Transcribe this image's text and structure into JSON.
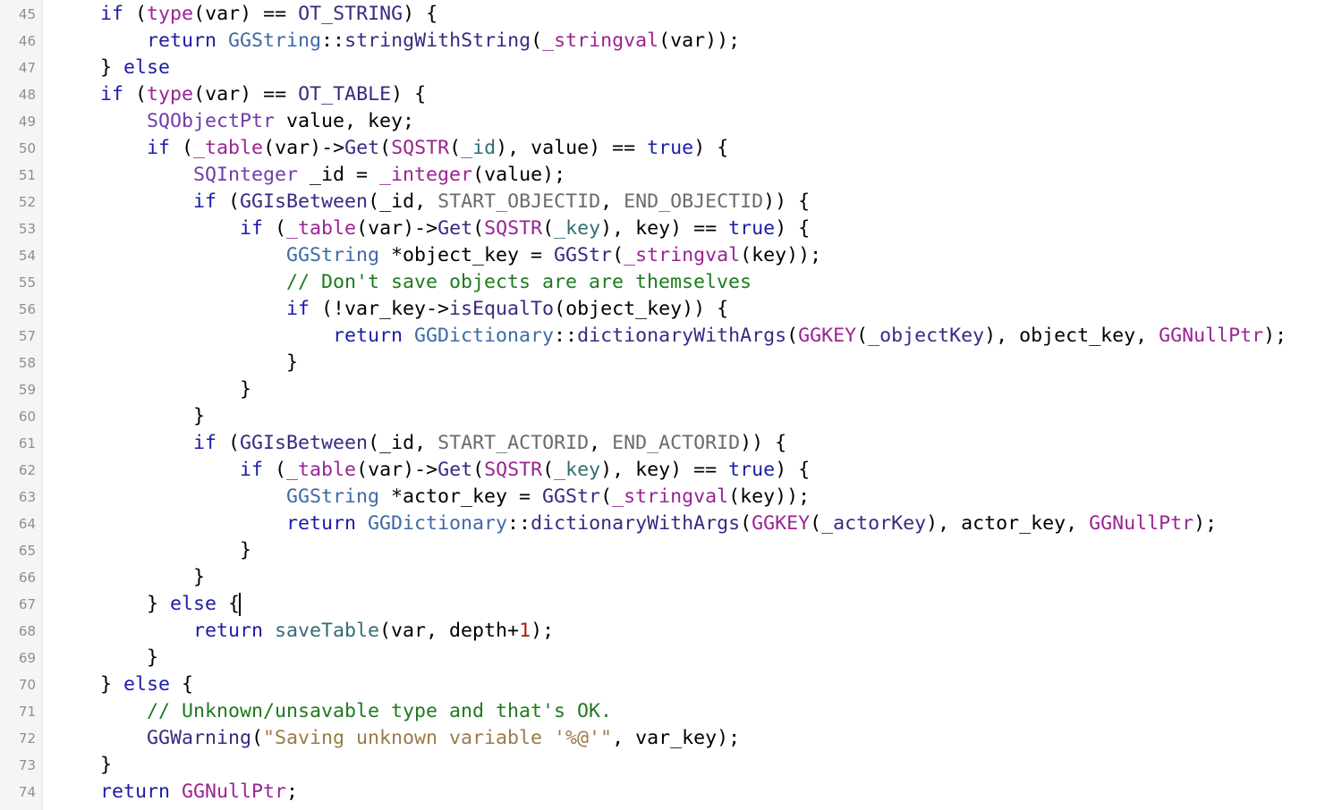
{
  "editor": {
    "cursor": {
      "line": 67,
      "after_token": "{"
    },
    "colors": {
      "keyword": "#1c1ca8",
      "function": "#9b2393",
      "class": "#3e6aa6",
      "type": "#703daa",
      "method": "#3b2882",
      "constant": "#6b6b6b",
      "variable": "#326d74",
      "number": "#b01818",
      "string": "#9c7a47",
      "comment": "#1e7a1e",
      "plain": "#000000",
      "gutter_bg": "#f5f5f5",
      "line_number": "#8e8e8e"
    },
    "lines": [
      {
        "n": "45",
        "indent": 4,
        "tokens": [
          [
            "kw",
            "if"
          ],
          [
            "plain",
            " ("
          ],
          [
            "fn",
            "type"
          ],
          [
            "plain",
            "(var) == "
          ],
          [
            "macro",
            "OT_STRING"
          ],
          [
            "plain",
            ") {"
          ]
        ]
      },
      {
        "n": "46",
        "indent": 8,
        "tokens": [
          [
            "kw",
            "return "
          ],
          [
            "cls",
            "GGString"
          ],
          [
            "plain",
            "::"
          ],
          [
            "meth",
            "stringWithString"
          ],
          [
            "plain",
            "("
          ],
          [
            "fn",
            "_stringval"
          ],
          [
            "plain",
            "(var));"
          ]
        ]
      },
      {
        "n": "47",
        "indent": 4,
        "tokens": [
          [
            "plain",
            "} "
          ],
          [
            "kw",
            "else"
          ]
        ]
      },
      {
        "n": "48",
        "indent": 4,
        "tokens": [
          [
            "kw",
            "if"
          ],
          [
            "plain",
            " ("
          ],
          [
            "fn",
            "type"
          ],
          [
            "plain",
            "(var) == "
          ],
          [
            "macro",
            "OT_TABLE"
          ],
          [
            "plain",
            ") {"
          ]
        ]
      },
      {
        "n": "49",
        "indent": 8,
        "tokens": [
          [
            "type",
            "SQObjectPtr"
          ],
          [
            "plain",
            " value, key;"
          ]
        ]
      },
      {
        "n": "50",
        "indent": 8,
        "tokens": [
          [
            "kw",
            "if"
          ],
          [
            "plain",
            " ("
          ],
          [
            "fn",
            "_table"
          ],
          [
            "plain",
            "(var)->"
          ],
          [
            "meth",
            "Get"
          ],
          [
            "plain",
            "("
          ],
          [
            "fn",
            "SQSTR"
          ],
          [
            "plain",
            "("
          ],
          [
            "var",
            "_id"
          ],
          [
            "plain",
            "), value) == "
          ],
          [
            "kw",
            "true"
          ],
          [
            "plain",
            ") {"
          ]
        ]
      },
      {
        "n": "51",
        "indent": 12,
        "tokens": [
          [
            "type",
            "SQInteger"
          ],
          [
            "plain",
            " _id = "
          ],
          [
            "fn",
            "_integer"
          ],
          [
            "plain",
            "(value);"
          ]
        ]
      },
      {
        "n": "52",
        "indent": 12,
        "tokens": [
          [
            "kw",
            "if"
          ],
          [
            "plain",
            " ("
          ],
          [
            "meth",
            "GGIsBetween"
          ],
          [
            "plain",
            "(_id, "
          ],
          [
            "const",
            "START_OBJECTID"
          ],
          [
            "plain",
            ", "
          ],
          [
            "const",
            "END_OBJECTID"
          ],
          [
            "plain",
            ")) {"
          ]
        ]
      },
      {
        "n": "53",
        "indent": 16,
        "tokens": [
          [
            "kw",
            "if"
          ],
          [
            "plain",
            " ("
          ],
          [
            "fn",
            "_table"
          ],
          [
            "plain",
            "(var)->"
          ],
          [
            "meth",
            "Get"
          ],
          [
            "plain",
            "("
          ],
          [
            "fn",
            "SQSTR"
          ],
          [
            "plain",
            "("
          ],
          [
            "var",
            "_key"
          ],
          [
            "plain",
            "), key) == "
          ],
          [
            "kw",
            "true"
          ],
          [
            "plain",
            ") {"
          ]
        ]
      },
      {
        "n": "54",
        "indent": 20,
        "tokens": [
          [
            "cls",
            "GGString"
          ],
          [
            "plain",
            " *object_key = "
          ],
          [
            "meth",
            "GGStr"
          ],
          [
            "plain",
            "("
          ],
          [
            "fn",
            "_stringval"
          ],
          [
            "plain",
            "(key));"
          ]
        ]
      },
      {
        "n": "55",
        "indent": 20,
        "tokens": [
          [
            "cmt",
            "// Don't save objects are are themselves"
          ]
        ]
      },
      {
        "n": "56",
        "indent": 20,
        "tokens": [
          [
            "kw",
            "if"
          ],
          [
            "plain",
            " (!var_key->"
          ],
          [
            "meth",
            "isEqualTo"
          ],
          [
            "plain",
            "(object_key)) {"
          ]
        ]
      },
      {
        "n": "57",
        "indent": 24,
        "tokens": [
          [
            "kw",
            "return "
          ],
          [
            "cls",
            "GGDictionary"
          ],
          [
            "plain",
            "::"
          ],
          [
            "meth",
            "dictionaryWithArgs"
          ],
          [
            "plain",
            "("
          ],
          [
            "fn",
            "GGKEY"
          ],
          [
            "plain",
            "("
          ],
          [
            "meth",
            "_objectKey"
          ],
          [
            "plain",
            "), object_key, "
          ],
          [
            "fn",
            "GGNullPtr"
          ],
          [
            "plain",
            ");"
          ]
        ]
      },
      {
        "n": "58",
        "indent": 20,
        "tokens": [
          [
            "plain",
            "}"
          ]
        ]
      },
      {
        "n": "59",
        "indent": 16,
        "tokens": [
          [
            "plain",
            "}"
          ]
        ]
      },
      {
        "n": "60",
        "indent": 12,
        "tokens": [
          [
            "plain",
            "}"
          ]
        ]
      },
      {
        "n": "61",
        "indent": 12,
        "tokens": [
          [
            "kw",
            "if"
          ],
          [
            "plain",
            " ("
          ],
          [
            "meth",
            "GGIsBetween"
          ],
          [
            "plain",
            "(_id, "
          ],
          [
            "const",
            "START_ACTORID"
          ],
          [
            "plain",
            ", "
          ],
          [
            "const",
            "END_ACTORID"
          ],
          [
            "plain",
            ")) {"
          ]
        ]
      },
      {
        "n": "62",
        "indent": 16,
        "tokens": [
          [
            "kw",
            "if"
          ],
          [
            "plain",
            " ("
          ],
          [
            "fn",
            "_table"
          ],
          [
            "plain",
            "(var)->"
          ],
          [
            "meth",
            "Get"
          ],
          [
            "plain",
            "("
          ],
          [
            "fn",
            "SQSTR"
          ],
          [
            "plain",
            "("
          ],
          [
            "var",
            "_key"
          ],
          [
            "plain",
            "), key) == "
          ],
          [
            "kw",
            "true"
          ],
          [
            "plain",
            ") {"
          ]
        ]
      },
      {
        "n": "63",
        "indent": 20,
        "tokens": [
          [
            "cls",
            "GGString"
          ],
          [
            "plain",
            " *actor_key = "
          ],
          [
            "meth",
            "GGStr"
          ],
          [
            "plain",
            "("
          ],
          [
            "fn",
            "_stringval"
          ],
          [
            "plain",
            "(key));"
          ]
        ]
      },
      {
        "n": "64",
        "indent": 20,
        "tokens": [
          [
            "kw",
            "return "
          ],
          [
            "cls",
            "GGDictionary"
          ],
          [
            "plain",
            "::"
          ],
          [
            "meth",
            "dictionaryWithArgs"
          ],
          [
            "plain",
            "("
          ],
          [
            "fn",
            "GGKEY"
          ],
          [
            "plain",
            "("
          ],
          [
            "meth",
            "_actorKey"
          ],
          [
            "plain",
            "), actor_key, "
          ],
          [
            "fn",
            "GGNullPtr"
          ],
          [
            "plain",
            ");"
          ]
        ]
      },
      {
        "n": "65",
        "indent": 16,
        "tokens": [
          [
            "plain",
            "}"
          ]
        ]
      },
      {
        "n": "66",
        "indent": 12,
        "tokens": [
          [
            "plain",
            "}"
          ]
        ]
      },
      {
        "n": "67",
        "indent": 8,
        "tokens": [
          [
            "plain",
            "} "
          ],
          [
            "kw",
            "else"
          ],
          [
            "plain",
            " {"
          ],
          [
            "caret",
            ""
          ]
        ]
      },
      {
        "n": "68",
        "indent": 12,
        "tokens": [
          [
            "kw",
            "return "
          ],
          [
            "var",
            "saveTable"
          ],
          [
            "plain",
            "(var, depth+"
          ],
          [
            "num",
            "1"
          ],
          [
            "plain",
            ");"
          ]
        ]
      },
      {
        "n": "69",
        "indent": 8,
        "tokens": [
          [
            "plain",
            "}"
          ]
        ]
      },
      {
        "n": "70",
        "indent": 4,
        "tokens": [
          [
            "plain",
            "} "
          ],
          [
            "kw",
            "else"
          ],
          [
            "plain",
            " {"
          ]
        ]
      },
      {
        "n": "71",
        "indent": 8,
        "tokens": [
          [
            "cmt",
            "// Unknown/unsavable type and that's OK."
          ]
        ]
      },
      {
        "n": "72",
        "indent": 8,
        "tokens": [
          [
            "meth",
            "GGWarning"
          ],
          [
            "plain",
            "("
          ],
          [
            "str",
            "\"Saving unknown variable '%@'\""
          ],
          [
            "plain",
            ", var_key);"
          ]
        ]
      },
      {
        "n": "73",
        "indent": 4,
        "tokens": [
          [
            "plain",
            "}"
          ]
        ]
      },
      {
        "n": "74",
        "indent": 4,
        "tokens": [
          [
            "kw",
            "return "
          ],
          [
            "fn",
            "GGNullPtr"
          ],
          [
            "plain",
            ";"
          ]
        ]
      }
    ]
  }
}
